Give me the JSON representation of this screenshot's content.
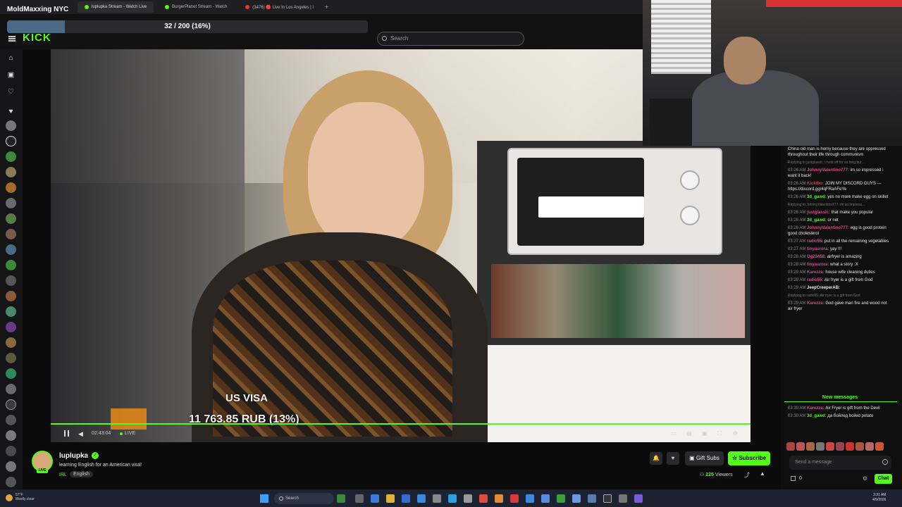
{
  "overlay_title": "MoldMaxxing NYC",
  "browser": {
    "tabs": [
      {
        "label": "luplupka Stream - Watch Live",
        "active": true
      },
      {
        "label": "BurgerPlanet Stream - Watch",
        "active": false
      },
      {
        "label": "(3476) 🔴 Live In Los Angeles | I",
        "active": false
      }
    ]
  },
  "header": {
    "logo": "KICK",
    "goal": {
      "text": "32 / 200 (16%)",
      "fraction": 0.16
    },
    "search_placeholder": "Search"
  },
  "video": {
    "visa_label": "US VISA",
    "visa_amount": "11 763.85 RUB (13%)",
    "visa_fraction": 0.13,
    "time": "02:43:04",
    "live": "LIVE"
  },
  "chat": {
    "messages": [
      {
        "time": "",
        "user": "",
        "text": "China old man is horny because they are oppressed throughout their life through communism",
        "type": "cont"
      },
      {
        "time": "",
        "user": "",
        "text": "Replying to justglassic: I hold off for so long but ...",
        "type": "reply"
      },
      {
        "time": "03:26 AM",
        "user": "JohnnyValentino777:",
        "text": "im so impressed i want it back!",
        "color": "#d24c8a"
      },
      {
        "time": "03:26 AM",
        "user": "Kicktbo:",
        "text": "JOIN MY DISCORD GUYS — https://discord.gg/4qFRaAFeYe",
        "color": "#c84545"
      },
      {
        "time": "03:26 AM",
        "user": "3d_gawd:",
        "text": "yes no more make egg on skillet",
        "color": "#53fc18"
      },
      {
        "time": "",
        "user": "",
        "text": "Replying to JohnnyValentino777: im so impress...",
        "type": "reply"
      },
      {
        "time": "03:26 AM",
        "user": "justglassic:",
        "text": "that make you popular",
        "color": "#d24c8a"
      },
      {
        "time": "03:26 AM",
        "user": "3d_gawd:",
        "text": "or not",
        "color": "#53fc18"
      },
      {
        "time": "03:26 AM",
        "user": "JohnnyValentino777:",
        "text": "egg is good protein good cholesterol",
        "color": "#d24c8a"
      },
      {
        "time": "03:27 AM",
        "user": "radio55:",
        "text": "put in all the remaining vegetables",
        "color": "#d24c8a"
      },
      {
        "time": "03:27 AM",
        "user": "tinyaurora:",
        "text": "yay !!!",
        "color": "#d24c8a"
      },
      {
        "time": "03:28 AM",
        "user": "Og23458:",
        "text": "airfryer is amazing",
        "color": "#d24c8a"
      },
      {
        "time": "03:28 AM",
        "user": "tinyaurora:",
        "text": "what a story :X",
        "color": "#d24c8a"
      },
      {
        "time": "03:29 AM",
        "user": "Karezza:",
        "text": "house wife cleaning duties",
        "color": "#d24c8a"
      },
      {
        "time": "03:29 AM",
        "user": "radio55:",
        "text": "Air fryer is a gift from God",
        "color": "#d24c8a"
      },
      {
        "time": "03:29 AM",
        "user": "JeepCreeperAB:",
        "text": "",
        "color": "#e8e8e8"
      },
      {
        "time": "",
        "user": "",
        "text": "Replying to radio55: Air fryer is a gift from God",
        "type": "reply"
      },
      {
        "time": "03:29 AM",
        "user": "Karezza:",
        "text": "God gave man fire and wood not air fryer",
        "color": "#d24c8a"
      }
    ],
    "new_messages_label": "New messages",
    "new_messages": [
      {
        "time": "03:30 AM",
        "user": "Karezza:",
        "text": "Air Fryer is gift from the Devil",
        "color": "#d24c8a"
      },
      {
        "time": "03:30 AM",
        "user": "3d_gawd:",
        "text": "да бойлед boiled potato",
        "color": "#53fc18"
      }
    ],
    "input_placeholder": "Send a message",
    "count": "0",
    "send_label": "Chat"
  },
  "streamer": {
    "name": "luplupka",
    "title": "learning  English for an American visa!",
    "category": "IRL",
    "language": "English",
    "live_badge": "LIVE",
    "gift_label": "Gift Subs",
    "subscribe_label": "Subscribe",
    "viewers_count": "225",
    "viewers_label": "Viewers"
  },
  "taskbar": {
    "weather_temp": "57°F",
    "weather_desc": "Mostly clear",
    "search_label": "Search",
    "time": "3:31 AM",
    "date": "4/9/2026"
  },
  "colors": {
    "accent": "#53fc18",
    "background": "#0b0b0c"
  }
}
